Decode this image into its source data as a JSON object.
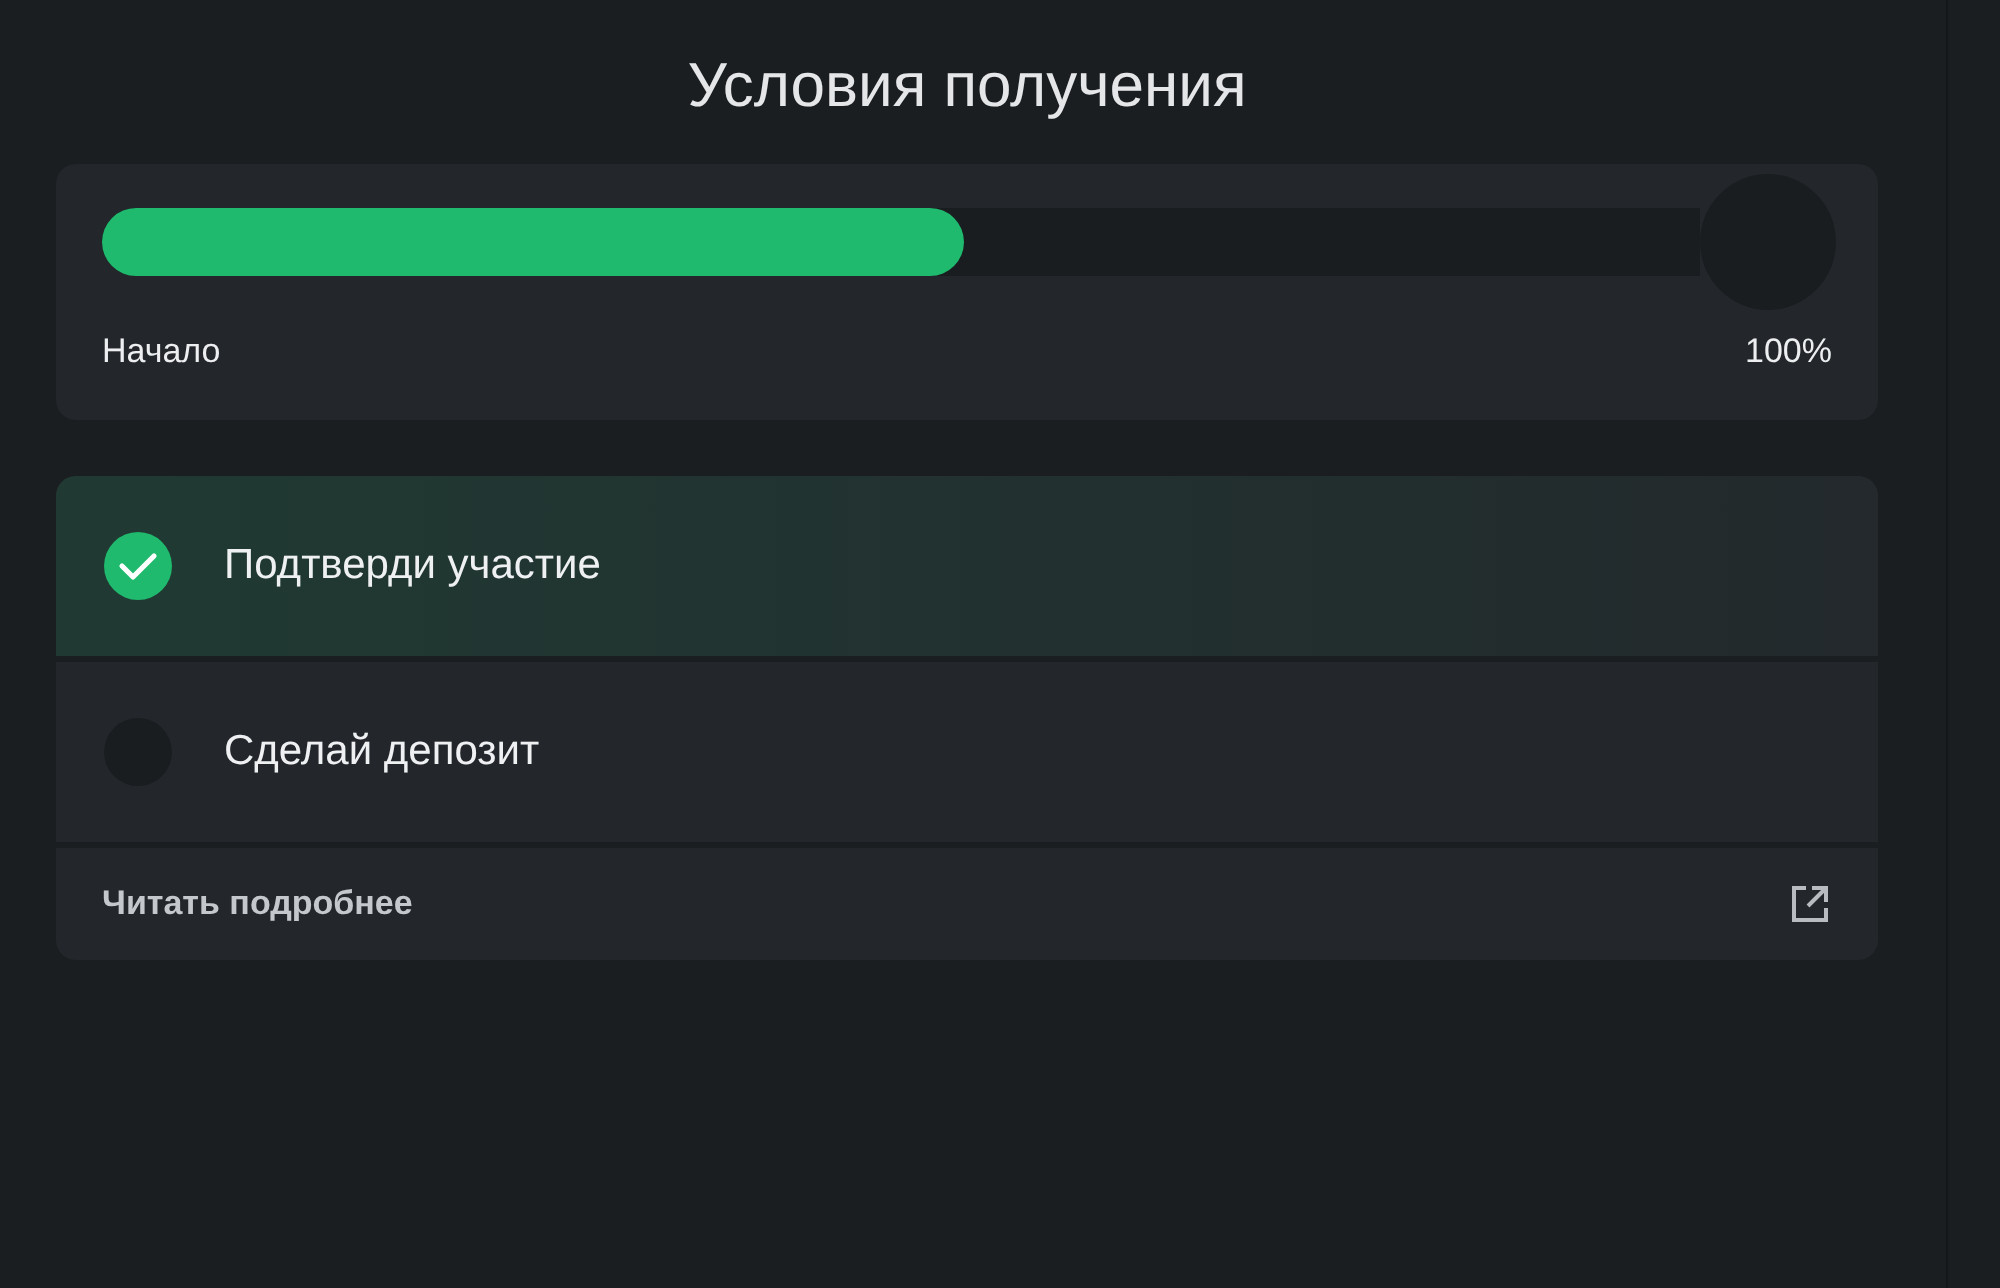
{
  "title": "Условия получения",
  "progress": {
    "level": 0.54,
    "start_label": "Начало",
    "end_label": "100%"
  },
  "steps": [
    {
      "label": "Подтверди участие",
      "done": true
    },
    {
      "label": "Сделай депозит",
      "done": false
    }
  ],
  "more_link": {
    "label": "Читать подробнее"
  }
}
